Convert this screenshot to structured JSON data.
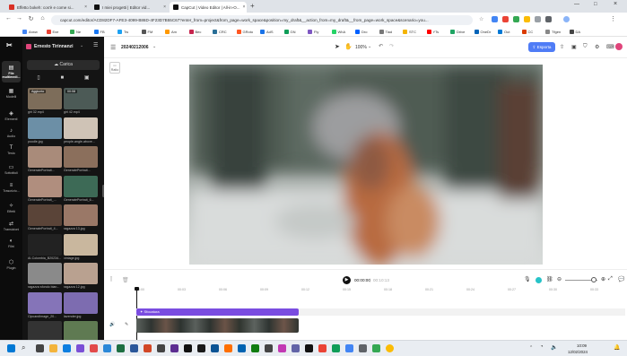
{
  "browser": {
    "tabs": [
      {
        "title": "Effetto bokeh: cos'è e come si...",
        "color": "#d93025"
      },
      {
        "title": "I miei progetti | Editor vid...",
        "color": "#111111"
      },
      {
        "title": "CapCut | Video Editor | All-in-O...",
        "color": "#111111"
      }
    ],
    "url": "capcut.com/editor/ACD82DF7-AFE3-4099-B86D-4F23D7B55C67?enter_from=project&from_page=work_space&position=my_draft&__action_from=my_draft&__from_page=work_space&scenario=you...",
    "bookmarks": [
      "Arww",
      "Exe",
      "Ne",
      "FB",
      "Tw",
      "FM",
      "Am",
      "Bec",
      "CRC",
      "GRoto",
      "AdS",
      "GN",
      "Fly",
      "WhA",
      "Dro",
      "Tiad",
      "STC",
      "YTs",
      "Drive",
      "OneDr",
      "Out",
      "CC",
      "Tfgen",
      "DA"
    ]
  },
  "sidebar": {
    "user_name": "Ernesto Tirinnanzi",
    "rail_items": [
      "File multimedi...",
      "Modelli",
      "Elementi",
      "Audio",
      "Testo",
      "Sottotitoli",
      "Trascrizio...",
      "Effetti",
      "Transizioni",
      "Filtri",
      "Plugin"
    ],
    "upload_label": "Carica",
    "media_items": [
      {
        "label": "girl 32.mp4",
        "badge": "Aggiunto",
        "color": "#7d6d5a"
      },
      {
        "label": "girl 42.mp4",
        "badge": "00:08",
        "color": "#4c5a56"
      },
      {
        "label": "poodle.jpg",
        "badge": "",
        "color": "#6c8fa6"
      },
      {
        "label": "people-angle-above...",
        "badge": "",
        "color": "#cfc3b6"
      },
      {
        "label": "GeneratePortrait...",
        "badge": "",
        "color": "#a98b7a"
      },
      {
        "label": "GeneratePortrait...",
        "badge": "",
        "color": "#8b6f5c"
      },
      {
        "label": "GeneratePortrait_...",
        "badge": "",
        "color": "#b08e7e"
      },
      {
        "label": "GeneratePortrait_6...",
        "badge": "",
        "color": "#3d6a56"
      },
      {
        "label": "GeneratePortrait_4...",
        "badge": "",
        "color": "#5a4438"
      },
      {
        "label": "ragazza 13.jpg",
        "badge": "",
        "color": "#9a7867"
      },
      {
        "label": "AI-Colombia_B20234...",
        "badge": "",
        "color": "#222222"
      },
      {
        "label": "vintage.jpg",
        "badge": "",
        "color": "#c9b79e"
      },
      {
        "label": "ragazza sfondo bian...",
        "badge": "",
        "color": "#8a8a8a"
      },
      {
        "label": "ragazza 12.jpg",
        "badge": "",
        "color": "#b9a190"
      },
      {
        "label": "CipcandImage_20...",
        "badge": "",
        "color": "#8574b8"
      },
      {
        "label": "lavender.jpg",
        "badge": "",
        "color": "#7d6cb0"
      },
      {
        "label": "",
        "badge": "",
        "color": "#333333"
      },
      {
        "label": "",
        "badge": "",
        "color": "#5f7a52"
      }
    ]
  },
  "editor": {
    "project_name": "20240212006",
    "zoom": "100%",
    "export_label": "Esporta",
    "ratio_label": "Ratio",
    "accent": "#4f7cf6"
  },
  "timeline": {
    "current_time": "00:00:00",
    "total_time": "00:10:13",
    "ruler_ticks": [
      "00:00",
      "00:03",
      "00:06",
      "00:09",
      "00:12",
      "00:15",
      "00:18",
      "00:21",
      "00:24",
      "00:27",
      "00:30",
      "00:33"
    ],
    "effect_clip_label": "Sfocatura",
    "effect_color": "#7a4ce0"
  },
  "taskbar": {
    "time": "10:09",
    "date": "12/02/2024"
  }
}
